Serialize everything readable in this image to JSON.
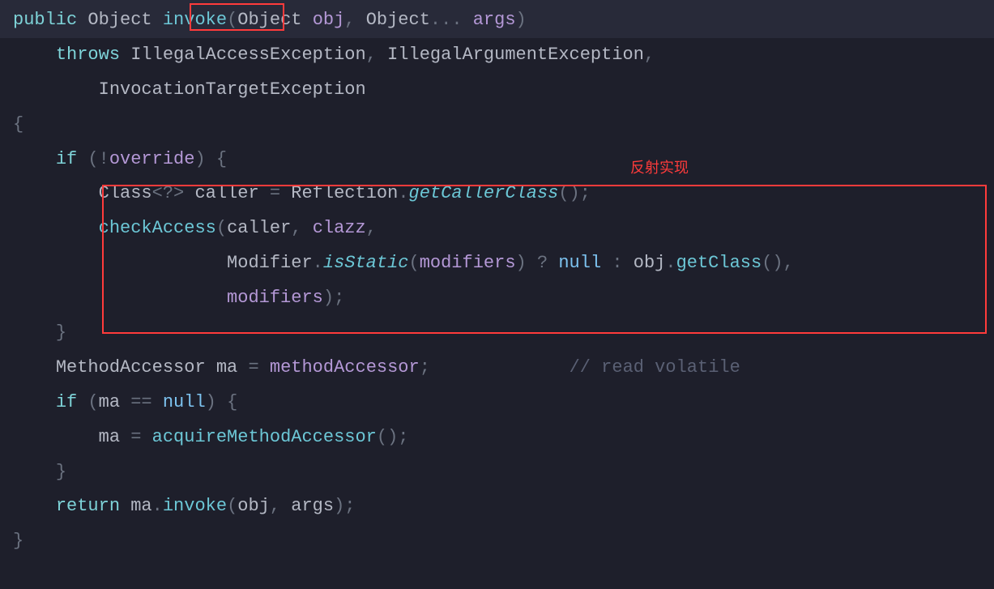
{
  "annotation": {
    "label": "反射实现"
  },
  "code": {
    "l1": {
      "public": "public",
      "Object1": "Object",
      "invoke": "invoke",
      "lparen": "(",
      "Object2": "Object",
      "obj": "obj",
      "comma": ",",
      "Object3": "Object",
      "dots": "...",
      "args": "args",
      "rparen": ")"
    },
    "l2": {
      "throws": "throws",
      "ex1": "IllegalAccessException",
      "ex2": "IllegalArgumentException",
      "comma": ","
    },
    "l3": {
      "ex3": "InvocationTargetException"
    },
    "l4": {
      "brace": "{"
    },
    "l5": {
      "if": "if",
      "lparen": "(",
      "not": "!",
      "override": "override",
      "rparen": ")",
      "brace": "{"
    },
    "l6": {
      "Class": "Class",
      "generic": "<?>",
      "caller": "caller",
      "eq": "=",
      "Reflection": "Reflection",
      "dot": ".",
      "getCallerClass": "getCallerClass",
      "parens": "()",
      "semi": ";"
    },
    "l7": {
      "checkAccess": "checkAccess",
      "lparen": "(",
      "caller": "caller",
      "comma1": ",",
      "clazz": "clazz",
      "comma2": ","
    },
    "l8": {
      "Modifier": "Modifier",
      "dot": ".",
      "isStatic": "isStatic",
      "lparen": "(",
      "modifiers": "modifiers",
      "rparen": ")",
      "q": "?",
      "null": "null",
      "colon": ":",
      "obj": "obj",
      "dot2": ".",
      "getClass": "getClass",
      "parens": "()",
      "comma": ","
    },
    "l9": {
      "modifiers": "modifiers",
      "rparen": ")",
      "semi": ";"
    },
    "l10": {
      "brace": "}"
    },
    "l11": {
      "MethodAccessor": "MethodAccessor",
      "ma": "ma",
      "eq": "=",
      "methodAccessor": "methodAccessor",
      "semi": ";",
      "comment": "// read volatile"
    },
    "l12": {
      "if": "if",
      "lparen": "(",
      "ma": "ma",
      "eqeq": "==",
      "null": "null",
      "rparen": ")",
      "brace": "{"
    },
    "l13": {
      "ma": "ma",
      "eq": "=",
      "acquireMethodAccessor": "acquireMethodAccessor",
      "parens": "()",
      "semi": ";"
    },
    "l14": {
      "brace": "}"
    },
    "l15": {
      "return": "return",
      "ma": "ma",
      "dot": ".",
      "invoke": "invoke",
      "lparen": "(",
      "obj": "obj",
      "comma": ",",
      "args": "args",
      "rparen": ")",
      "semi": ";"
    },
    "l16": {
      "brace": "}"
    }
  }
}
